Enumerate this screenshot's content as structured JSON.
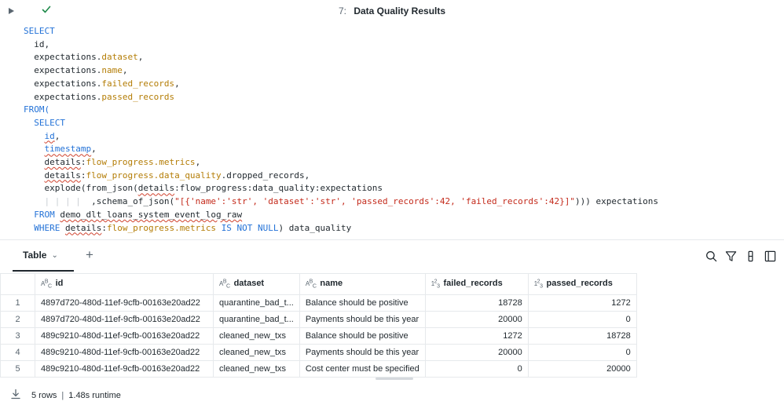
{
  "cell": {
    "number": "7:",
    "title": "Data Quality Results"
  },
  "code": {
    "l1_kw": "SELECT",
    "l2": "id,",
    "l3_ex": "expectations.",
    "l3_f": "dataset",
    "l4_ex": "expectations.",
    "l4_f": "name",
    "l5_ex": "expectations.",
    "l5_f": "failed_records",
    "l6_ex": "expectations.",
    "l6_f": "passed_records",
    "l7_kw": "FROM(",
    "l8_kw": "SELECT",
    "l9": "id",
    "l10": "timestamp",
    "l11_a": "details",
    "l11_b": "flow_progress.metrics",
    "l12_a": "details",
    "l12_b": "flow_progress.data_quality",
    "l12_c": ".dropped_records,",
    "l13_a": "explode(from_json(",
    "l13_b": "details",
    "l13_c": ":flow_progress:data_quality:expectations",
    "l14_a": ",schema_of_json(",
    "l14_s": "\"[{'name':'str', 'dataset':'str', 'passed_records':42, 'failed_records':42}]\"",
    "l14_c": "))) expectations",
    "l15_kw": "FROM",
    "l15_t": "demo_dlt_loans_system_event_log_raw",
    "l16_kw1": "WHERE",
    "l16_a": "details",
    "l16_b": "flow_progress.metrics",
    "l16_kw2": "IS NOT NULL",
    "l16_c": ") data_quality"
  },
  "results": {
    "tab_label": "Table",
    "add_label": "+",
    "columns": [
      {
        "name": "id",
        "type_icon": "string-type-icon"
      },
      {
        "name": "dataset",
        "type_icon": "string-type-icon"
      },
      {
        "name": "name",
        "type_icon": "string-type-icon"
      },
      {
        "name": "failed_records",
        "type_icon": "number-type-icon"
      },
      {
        "name": "passed_records",
        "type_icon": "number-type-icon"
      }
    ],
    "rows": [
      {
        "n": "1",
        "id": "4897d720-480d-11ef-9cfb-00163e20ad22",
        "dataset": "quarantine_bad_t...",
        "name": "Balance should be positive",
        "failed": "18728",
        "passed": "1272"
      },
      {
        "n": "2",
        "id": "4897d720-480d-11ef-9cfb-00163e20ad22",
        "dataset": "quarantine_bad_t...",
        "name": "Payments should be this year",
        "failed": "20000",
        "passed": "0"
      },
      {
        "n": "3",
        "id": "489c9210-480d-11ef-9cfb-00163e20ad22",
        "dataset": "cleaned_new_txs",
        "name": "Balance should be positive",
        "failed": "1272",
        "passed": "18728"
      },
      {
        "n": "4",
        "id": "489c9210-480d-11ef-9cfb-00163e20ad22",
        "dataset": "cleaned_new_txs",
        "name": "Payments should be this year",
        "failed": "20000",
        "passed": "0"
      },
      {
        "n": "5",
        "id": "489c9210-480d-11ef-9cfb-00163e20ad22",
        "dataset": "cleaned_new_txs",
        "name": "Cost center must be specified",
        "failed": "0",
        "passed": "20000"
      }
    ]
  },
  "footer": {
    "rows_text": "5 rows",
    "separator": "|",
    "runtime_text": "1.48s runtime"
  },
  "colors": {
    "keyword": "#2372d7",
    "field": "#b47d06",
    "string": "#c42b1c",
    "success": "#1e8a4a"
  }
}
